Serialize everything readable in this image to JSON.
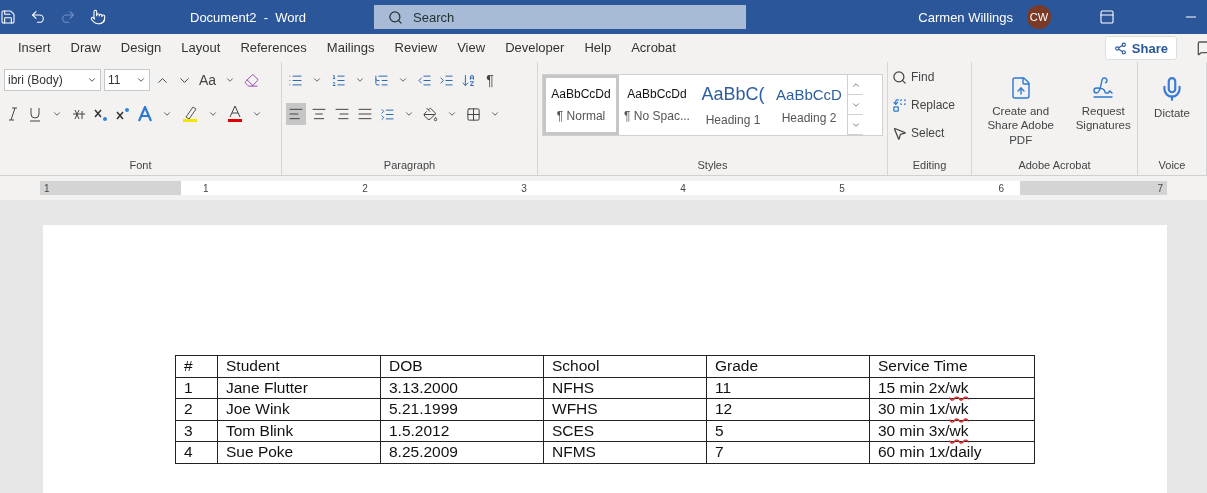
{
  "title_bar": {
    "title": "Document2  -  Word",
    "search": {
      "placeholder": "Search"
    },
    "user": {
      "name": "Carmen Willings",
      "initials": "CW"
    }
  },
  "tabs": [
    {
      "label": "Insert",
      "selected": false
    },
    {
      "label": "Draw",
      "selected": false
    },
    {
      "label": "Design",
      "selected": false
    },
    {
      "label": "Layout",
      "selected": false
    },
    {
      "label": "References",
      "selected": false
    },
    {
      "label": "Mailings",
      "selected": false
    },
    {
      "label": "Review",
      "selected": false
    },
    {
      "label": "View",
      "selected": false
    },
    {
      "label": "Developer",
      "selected": false
    },
    {
      "label": "Help",
      "selected": false
    },
    {
      "label": "Acrobat",
      "selected": false
    }
  ],
  "share_button": "Share",
  "ribbon": {
    "font": {
      "label": "Font",
      "font_name": "ibri (Body)",
      "font_size": "11",
      "case_button": "Aa"
    },
    "paragraph": {
      "label": "Paragraph",
      "alignment_buttons": [
        {
          "kind": "left",
          "selected": true
        },
        {
          "kind": "center",
          "selected": false
        },
        {
          "kind": "right",
          "selected": false
        },
        {
          "kind": "justify",
          "selected": false
        }
      ],
      "show_marks": "¶"
    },
    "styles": {
      "label": "Styles",
      "items": [
        {
          "preview": "AaBbCcDd",
          "name": "¶ Normal",
          "kind": "body",
          "selected": true
        },
        {
          "preview": "AaBbCcDd",
          "name": "¶ No Spac...",
          "kind": "body",
          "selected": false
        },
        {
          "preview": "AaBbC(",
          "name": "Heading 1",
          "kind": "heading1",
          "selected": false
        },
        {
          "preview": "AaBbCcD",
          "name": "Heading 2",
          "kind": "heading2",
          "selected": false
        }
      ]
    },
    "editing": {
      "label": "Editing",
      "items": [
        {
          "label": "Find",
          "kind": "find"
        },
        {
          "label": "Replace",
          "kind": "replace"
        },
        {
          "label": "Select",
          "kind": "select"
        }
      ]
    },
    "acrobat": {
      "label": "Adobe Acrobat",
      "buttons": [
        {
          "label": "Create and Share Adobe PDF",
          "kind": "pdf"
        },
        {
          "label": "Request Signatures",
          "kind": "sign"
        }
      ]
    },
    "voice": {
      "label": "Voice",
      "button": "Dictate"
    }
  },
  "ruler": {
    "numbers": [
      "1",
      "1",
      "2",
      "3",
      "4",
      "5",
      "6",
      "7"
    ]
  },
  "table": {
    "columns": [
      "#",
      "Student",
      "DOB",
      "School",
      "Grade",
      "Service Time"
    ],
    "rows": [
      {
        "cells": [
          "1",
          "Jane Flutter",
          "3.13.2000",
          "NFHS",
          "11",
          "15 min 2x/wk"
        ],
        "spelling_flag": true
      },
      {
        "cells": [
          "2",
          "Joe Wink",
          "5.21.1999",
          "WFHS",
          "12",
          "30 min 1x/wk"
        ],
        "spelling_flag": true
      },
      {
        "cells": [
          "3",
          "Tom Blink",
          "1.5.2012",
          "SCES",
          "5",
          "30 min 3x/wk"
        ],
        "spelling_flag": true
      },
      {
        "cells": [
          "4",
          "Sue Poke",
          "8.25.2009",
          "NFMS",
          "7",
          "60 min 1x/daily"
        ],
        "spelling_flag": false
      }
    ]
  }
}
